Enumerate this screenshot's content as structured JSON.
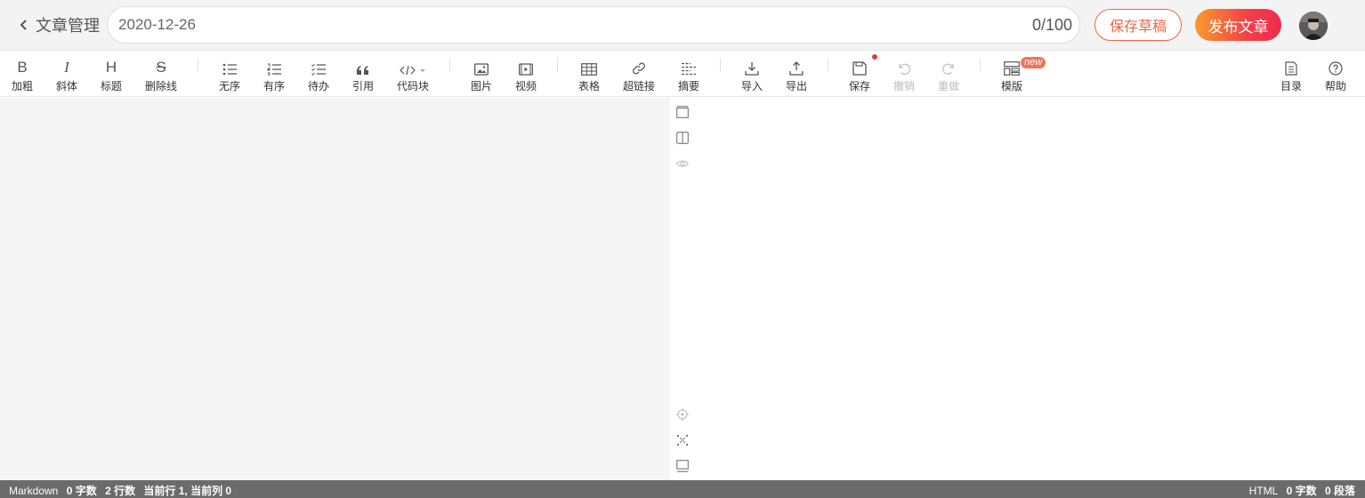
{
  "header": {
    "back_label": "文章管理",
    "title_value": "2020-12-26",
    "title_count": "0/100",
    "save_draft_label": "保存草稿",
    "publish_label": "发布文章"
  },
  "toolbar": {
    "bold": "加粗",
    "italic": "斜体",
    "heading": "标题",
    "strikethrough": "删除线",
    "unordered": "无序",
    "ordered": "有序",
    "todo": "待办",
    "quote": "引用",
    "codeblock": "代码块",
    "image": "图片",
    "video": "视频",
    "table": "表格",
    "link": "超链接",
    "summary": "摘要",
    "import": "导入",
    "export": "导出",
    "save": "保存",
    "undo": "撤销",
    "redo": "重做",
    "template": "模版",
    "template_badge": "new",
    "toc": "目录",
    "help": "帮助",
    "glyph_bold": "B",
    "glyph_italic": "I",
    "glyph_heading": "H",
    "glyph_strike": "S"
  },
  "status": {
    "left_mode": "Markdown",
    "left_chars": "0 字数",
    "left_lines": "2 行数",
    "left_cursor": "当前行 1, 当前列 0",
    "right_mode": "HTML",
    "right_chars": "0 字数",
    "right_paragraphs": "0 段落"
  },
  "colors": {
    "accent": "#f06643",
    "publish_gradient_start": "#f89a2c",
    "publish_gradient_end": "#ee2b4d",
    "editor_bg": "#f5f5f5",
    "status_bg": "#6b6b6b"
  }
}
